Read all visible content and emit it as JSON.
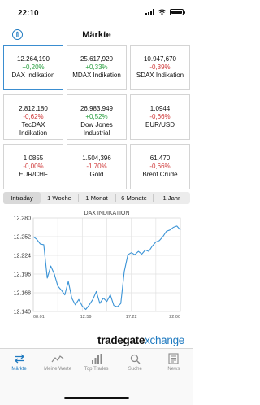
{
  "status": {
    "time": "22:10"
  },
  "nav": {
    "title": "Märkte"
  },
  "tiles": [
    {
      "value": "12.264,190",
      "change": "+0,20%",
      "name": "DAX Indikation",
      "name2": "",
      "positive": true
    },
    {
      "value": "25.617,920",
      "change": "+0,33%",
      "name": "MDAX Indikation",
      "name2": "",
      "positive": true
    },
    {
      "value": "10.947,670",
      "change": "-0,39%",
      "name": "SDAX Indikation",
      "name2": "",
      "positive": false
    },
    {
      "value": "2.812,180",
      "change": "-0,62%",
      "name": "TecDAX",
      "name2": "Indikation",
      "positive": false
    },
    {
      "value": "26.983,949",
      "change": "+0,52%",
      "name": "Dow Jones",
      "name2": "Industrial",
      "positive": true
    },
    {
      "value": "1,0944",
      "change": "-0,66%",
      "name": "EUR/USD",
      "name2": "",
      "positive": false
    },
    {
      "value": "1,0855",
      "change": "-0,00%",
      "name": "EUR/CHF",
      "name2": "",
      "positive": false
    },
    {
      "value": "1.504,396",
      "change": "-1,70%",
      "name": "Gold",
      "name2": "",
      "positive": false
    },
    {
      "value": "61,470",
      "change": "-0,66%",
      "name": "Brent Crude",
      "name2": "",
      "positive": false
    }
  ],
  "ranges": [
    "Intraday",
    "1 Woche",
    "1 Monat",
    "6 Monate",
    "1 Jahr"
  ],
  "selected_range": "Intraday",
  "chart_data": {
    "type": "line",
    "title": "DAX INDIKATION",
    "xlabel": "",
    "ylabel": "",
    "ylim": [
      12140,
      12280
    ],
    "y_ticks": [
      "12.280",
      "12.252",
      "12.224",
      "12.196",
      "12.168",
      "12.140"
    ],
    "x_ticks": [
      "08:01",
      "12:59",
      "17:22",
      "22:00"
    ],
    "x": [
      "08:01",
      "08:20",
      "08:40",
      "09:00",
      "09:20",
      "09:40",
      "10:00",
      "10:20",
      "10:40",
      "11:00",
      "11:20",
      "11:40",
      "12:00",
      "12:20",
      "12:40",
      "12:59",
      "13:20",
      "13:40",
      "14:00",
      "14:20",
      "14:40",
      "15:00",
      "15:20",
      "15:40",
      "16:00",
      "16:20",
      "16:40",
      "17:00",
      "17:22",
      "17:40",
      "18:00",
      "18:20",
      "18:40",
      "19:00",
      "19:20",
      "19:40",
      "20:00",
      "20:20",
      "20:40",
      "21:00",
      "21:20",
      "21:40",
      "22:00"
    ],
    "series": [
      {
        "name": "",
        "values": [
          12252,
          12248,
          12241,
          12240,
          12190,
          12208,
          12196,
          12178,
          12172,
          12165,
          12185,
          12160,
          12150,
          12158,
          12148,
          12143,
          12150,
          12158,
          12170,
          12152,
          12160,
          12155,
          12165,
          12149,
          12147,
          12152,
          12200,
          12225,
          12228,
          12225,
          12230,
          12226,
          12232,
          12230,
          12238,
          12244,
          12246,
          12252,
          12260,
          12262,
          12266,
          12268,
          12262
        ]
      }
    ],
    "line_color": "#3a93d6",
    "grid": true
  },
  "brand": {
    "part1": "tradegate",
    "part2": "xchange"
  },
  "tabs": [
    {
      "label": "Märkte",
      "icon": "arrows-swap-icon",
      "selected": true
    },
    {
      "label": "Meine Werte",
      "icon": "line-chart-icon",
      "selected": false
    },
    {
      "label": "Top Trades",
      "icon": "bar-chart-icon",
      "selected": false
    },
    {
      "label": "Suche",
      "icon": "search-icon",
      "selected": false
    },
    {
      "label": "News",
      "icon": "newspaper-icon",
      "selected": false
    }
  ],
  "colors": {
    "accent": "#1f7ac0",
    "positive": "#2aa040",
    "negative": "#d03a3a"
  }
}
